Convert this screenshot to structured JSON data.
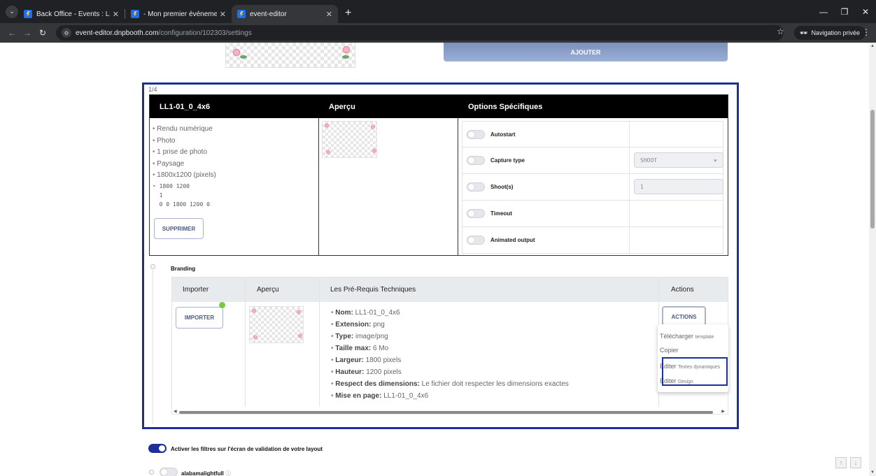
{
  "browser": {
    "tabs": [
      {
        "title": "Back Office - Events : List",
        "active": false
      },
      {
        "title": "- Mon premier événement (DN",
        "active": false
      },
      {
        "title": "event-editor",
        "active": true
      }
    ],
    "url_host": "event-editor.dnpbooth.com",
    "url_path": "/configuration/102303/settings",
    "private_label": "Navigation privée"
  },
  "header": {
    "add_button": "AJOUTER"
  },
  "layout_card": {
    "pager": "1/4",
    "columns": [
      "LL1-01_0_4x6",
      "Aperçu",
      "Options Spécifiques"
    ],
    "features": [
      "Rendu numérique",
      "Photo",
      "1 prise de photo",
      "Paysage",
      "1800x1200 (pixels)"
    ],
    "raw_lines": [
      "1800 1200",
      "1",
      "0 0 1800 1200 0"
    ],
    "delete_button": "SUPPRIMER",
    "options": [
      {
        "label": "Autostart",
        "value": ""
      },
      {
        "label": "Capture type",
        "value": "SHOOT"
      },
      {
        "label": "Shoot(s)",
        "value": "1"
      },
      {
        "label": "Timeout",
        "value": ""
      },
      {
        "label": "Animated output",
        "value": ""
      }
    ]
  },
  "branding": {
    "label": "Branding",
    "columns": [
      "Importer",
      "Aperçu",
      "Les Pré-Requis Techniques",
      "Actions"
    ],
    "import_button": "IMPORTER",
    "actions_button": "ACTIONS",
    "requirements": [
      {
        "key": "Nom:",
        "value": "LL1-01_0_4x6"
      },
      {
        "key": "Extension:",
        "value": "png"
      },
      {
        "key": "Type:",
        "value": "image/png"
      },
      {
        "key": "Taille max:",
        "value": "6 Mo"
      },
      {
        "key": "Largeur:",
        "value": "1800 pixels"
      },
      {
        "key": "Hauteur:",
        "value": "1200 pixels"
      },
      {
        "key": "Respect des dimensions:",
        "value": "Le fichier doit respecter les dimensions exactes"
      },
      {
        "key": "Mise en page:",
        "value": "LL1-01_0_4x6"
      }
    ],
    "menu": [
      {
        "main": "Télécharger",
        "sub": "template"
      },
      {
        "main": "Copier",
        "sub": ""
      },
      {
        "main": "Éditer",
        "sub": "Textes dynamiques"
      },
      {
        "main": "Éditer",
        "sub": "Design"
      }
    ]
  },
  "bottom": {
    "filters_label": "Activer les filtres sur l'écran de validation de votre layout",
    "filters_on": true,
    "filter_item": "alabamalightfull",
    "help_icon": "ⓘ"
  },
  "colors": {
    "accent": "#1e2e9a",
    "add_button": "#8ea2cb",
    "status_green": "#7ac943"
  }
}
